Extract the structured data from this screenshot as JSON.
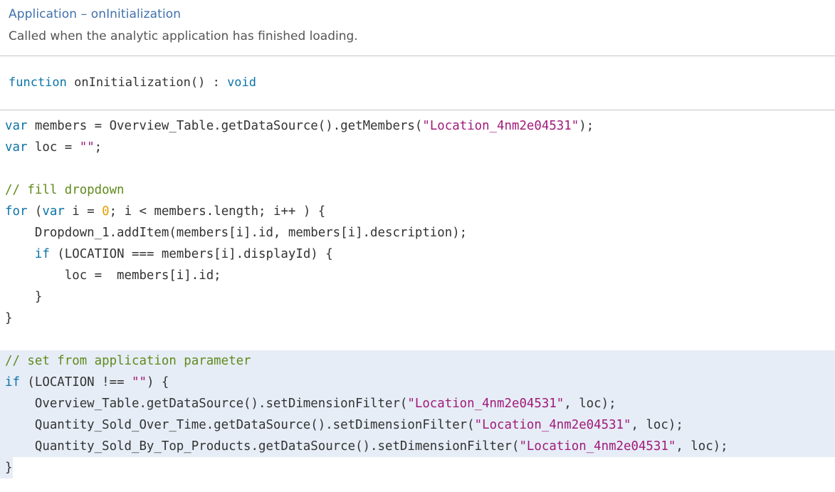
{
  "header": {
    "title": "Application – onInitialization",
    "description": "Called when the analytic application has finished loading."
  },
  "signature": [
    {
      "t": "kw",
      "s": "function"
    },
    {
      "t": "pl",
      "s": " onInitialization() : "
    },
    {
      "t": "kw",
      "s": "void"
    }
  ],
  "code_lines": [
    [
      {
        "t": "kw",
        "s": "var"
      },
      {
        "t": "pl",
        "s": " members = Overview_Table.getDataSource().getMembers("
      },
      {
        "t": "str",
        "s": "\"Location_4nm2e04531\""
      },
      {
        "t": "pl",
        "s": ");"
      }
    ],
    [
      {
        "t": "kw",
        "s": "var"
      },
      {
        "t": "pl",
        "s": " loc = "
      },
      {
        "t": "str",
        "s": "\"\""
      },
      {
        "t": "pl",
        "s": ";"
      }
    ],
    [],
    [
      {
        "t": "cm",
        "s": "// fill dropdown"
      }
    ],
    [
      {
        "t": "kw",
        "s": "for"
      },
      {
        "t": "pl",
        "s": " ("
      },
      {
        "t": "kw",
        "s": "var"
      },
      {
        "t": "pl",
        "s": " i = "
      },
      {
        "t": "num",
        "s": "0"
      },
      {
        "t": "pl",
        "s": "; i < members.length; i++ ) {"
      }
    ],
    [
      {
        "t": "pl",
        "s": "    Dropdown_1.addItem(members[i].id, members[i].description);"
      }
    ],
    [
      {
        "t": "pl",
        "s": "    "
      },
      {
        "t": "kw",
        "s": "if"
      },
      {
        "t": "pl",
        "s": " (LOCATION === members[i].displayId) {"
      }
    ],
    [
      {
        "t": "pl",
        "s": "        loc =  members[i].id;"
      }
    ],
    [
      {
        "t": "pl",
        "s": "    }"
      }
    ],
    [
      {
        "t": "pl",
        "s": "}"
      }
    ],
    [],
    [
      {
        "t": "cm",
        "s": "// set from application parameter"
      }
    ],
    [
      {
        "t": "kw",
        "s": "if"
      },
      {
        "t": "pl",
        "s": " (LOCATION !== "
      },
      {
        "t": "str",
        "s": "\"\""
      },
      {
        "t": "pl",
        "s": ") {"
      }
    ],
    [
      {
        "t": "pl",
        "s": "    Overview_Table.getDataSource().setDimensionFilter("
      },
      {
        "t": "str",
        "s": "\"Location_4nm2e04531\""
      },
      {
        "t": "pl",
        "s": ", loc);"
      }
    ],
    [
      {
        "t": "pl",
        "s": "    Quantity_Sold_Over_Time.getDataSource().setDimensionFilter("
      },
      {
        "t": "str",
        "s": "\"Location_4nm2e04531\""
      },
      {
        "t": "pl",
        "s": ", loc);"
      }
    ],
    [
      {
        "t": "pl",
        "s": "    Quantity_Sold_By_Top_Products.getDataSource().setDimensionFilter("
      },
      {
        "t": "str",
        "s": "\"Location_4nm2e04531\""
      },
      {
        "t": "pl",
        "s": ", loc);"
      }
    ],
    [
      {
        "t": "pl",
        "s": "}"
      }
    ]
  ],
  "colors": {
    "keyword": "#0b74a8",
    "string": "#a11a7a",
    "number": "#e5a000",
    "comment": "#5f8a1c",
    "plain": "#333333",
    "title": "#3f71ac",
    "highlight": "#e6edf6"
  }
}
